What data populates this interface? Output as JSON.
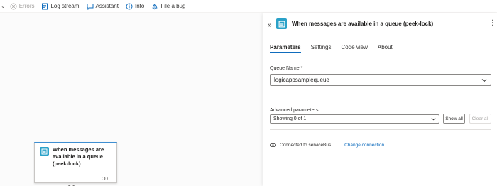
{
  "toolbar": {
    "items": [
      {
        "label": "Errors",
        "icon": "error-circle-icon",
        "enabled": false
      },
      {
        "label": "Log stream",
        "icon": "log-stream-icon",
        "enabled": true
      },
      {
        "label": "Assistant",
        "icon": "chat-icon",
        "enabled": true
      },
      {
        "label": "Info",
        "icon": "info-icon",
        "enabled": true
      },
      {
        "label": "File a bug",
        "icon": "bug-icon",
        "enabled": true
      }
    ]
  },
  "canvas": {
    "trigger_node": {
      "title": "When messages are available in a queue (peek-lock)",
      "icon": "service-bus-icon",
      "footer_icon": "link-icon"
    },
    "add_button_icon": "plus-icon"
  },
  "panel": {
    "title": "When messages are available in a queue (peek-lock)",
    "icon": "service-bus-icon",
    "tabs": [
      {
        "label": "Parameters",
        "active": true
      },
      {
        "label": "Settings",
        "active": false
      },
      {
        "label": "Code view",
        "active": false
      },
      {
        "label": "About",
        "active": false
      }
    ],
    "queue_name": {
      "label": "Queue Name *",
      "value": "logicappsamplequeue"
    },
    "advanced": {
      "label": "Advanced parameters",
      "value": "Showing 0 of 1",
      "show_all": "Show all",
      "clear_all": "Clear all"
    },
    "connection": {
      "text": "Connected to serviceBus.",
      "change_link": "Change connection"
    }
  },
  "colors": {
    "accent": "#0f6cbd",
    "service_bus": "#2aa1c8",
    "node_border_top": "#3f8fd2"
  }
}
